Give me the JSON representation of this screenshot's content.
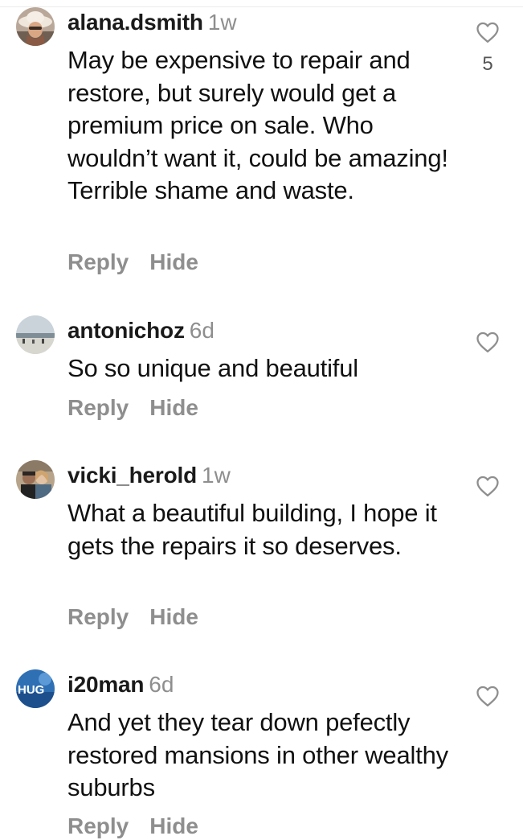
{
  "ui": {
    "reply_label": "Reply",
    "hide_label": "Hide"
  },
  "colors": {
    "secondary_text": "#8e8e8e",
    "primary_text": "#111111",
    "background": "#ffffff"
  },
  "comments": [
    {
      "username": "alana.dsmith",
      "time": "1w",
      "text": "May be expensive to repair and restore, but surely would get a premium price on sale. Who wouldn’t want it, could be amazing! Terrible shame and waste.",
      "likes": "5",
      "avatar_icon": "woman-sun-hat-avatar"
    },
    {
      "username": "antonichoz",
      "time": "6d",
      "text": "So so unique and beautiful",
      "likes": "",
      "avatar_icon": "seaside-landscape-avatar"
    },
    {
      "username": "vicki_herold",
      "time": "1w",
      "text": "What a beautiful building, I hope it gets the repairs it so deserves.",
      "likes": "",
      "avatar_icon": "couple-photo-avatar"
    },
    {
      "username": "i20man",
      "time": "6d",
      "text": "And yet they tear down pefectly restored mansions in other wealthy suburbs",
      "likes": "",
      "avatar_icon": "hug-logo-avatar",
      "avatar_text": "HUG"
    }
  ]
}
